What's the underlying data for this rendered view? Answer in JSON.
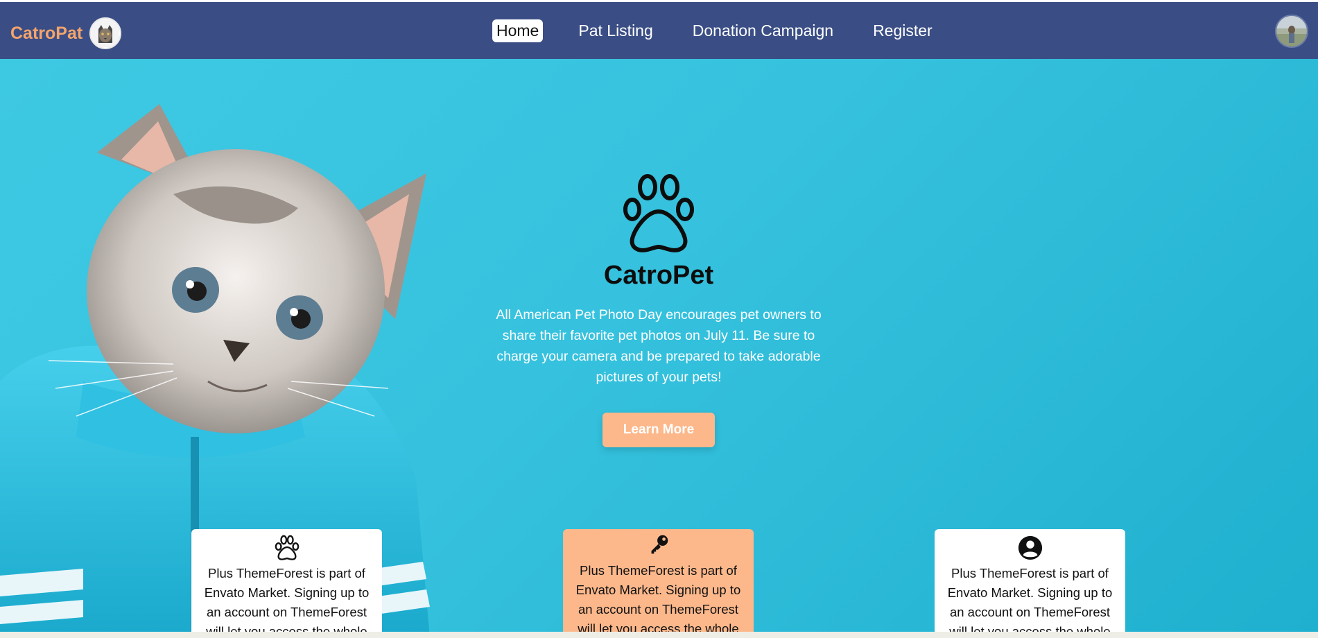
{
  "brand": {
    "name": "CatroPat"
  },
  "nav": {
    "items": [
      {
        "label": "Home",
        "active": true
      },
      {
        "label": "Pat Listing",
        "active": false
      },
      {
        "label": "Donation Campaign",
        "active": false
      },
      {
        "label": "Register",
        "active": false
      }
    ]
  },
  "hero": {
    "title": "CatroPet",
    "description": "All American Pet Photo Day encourages pet owners to share their favorite pet photos on July 11. Be sure to charge your camera and be prepared to take adorable pictures of your pets!",
    "button_label": "Learn More"
  },
  "cards": [
    {
      "icon": "paw-icon",
      "text": "Plus ThemeForest is part of Envato Market. Signing up to an account on ThemeForest will let you access the whole"
    },
    {
      "icon": "key-icon",
      "text": "Plus ThemeForest is part of Envato Market. Signing up to an account on ThemeForest will let you access the whole"
    },
    {
      "icon": "user-icon",
      "text": "Plus ThemeForest is part of Envato Market. Signing up to an account on ThemeForest will let you access the whole"
    }
  ],
  "colors": {
    "navbar": "#3a4e85",
    "brand": "#f4a46c",
    "accent": "#fcb88b",
    "hero_bg": "#36c2de"
  }
}
